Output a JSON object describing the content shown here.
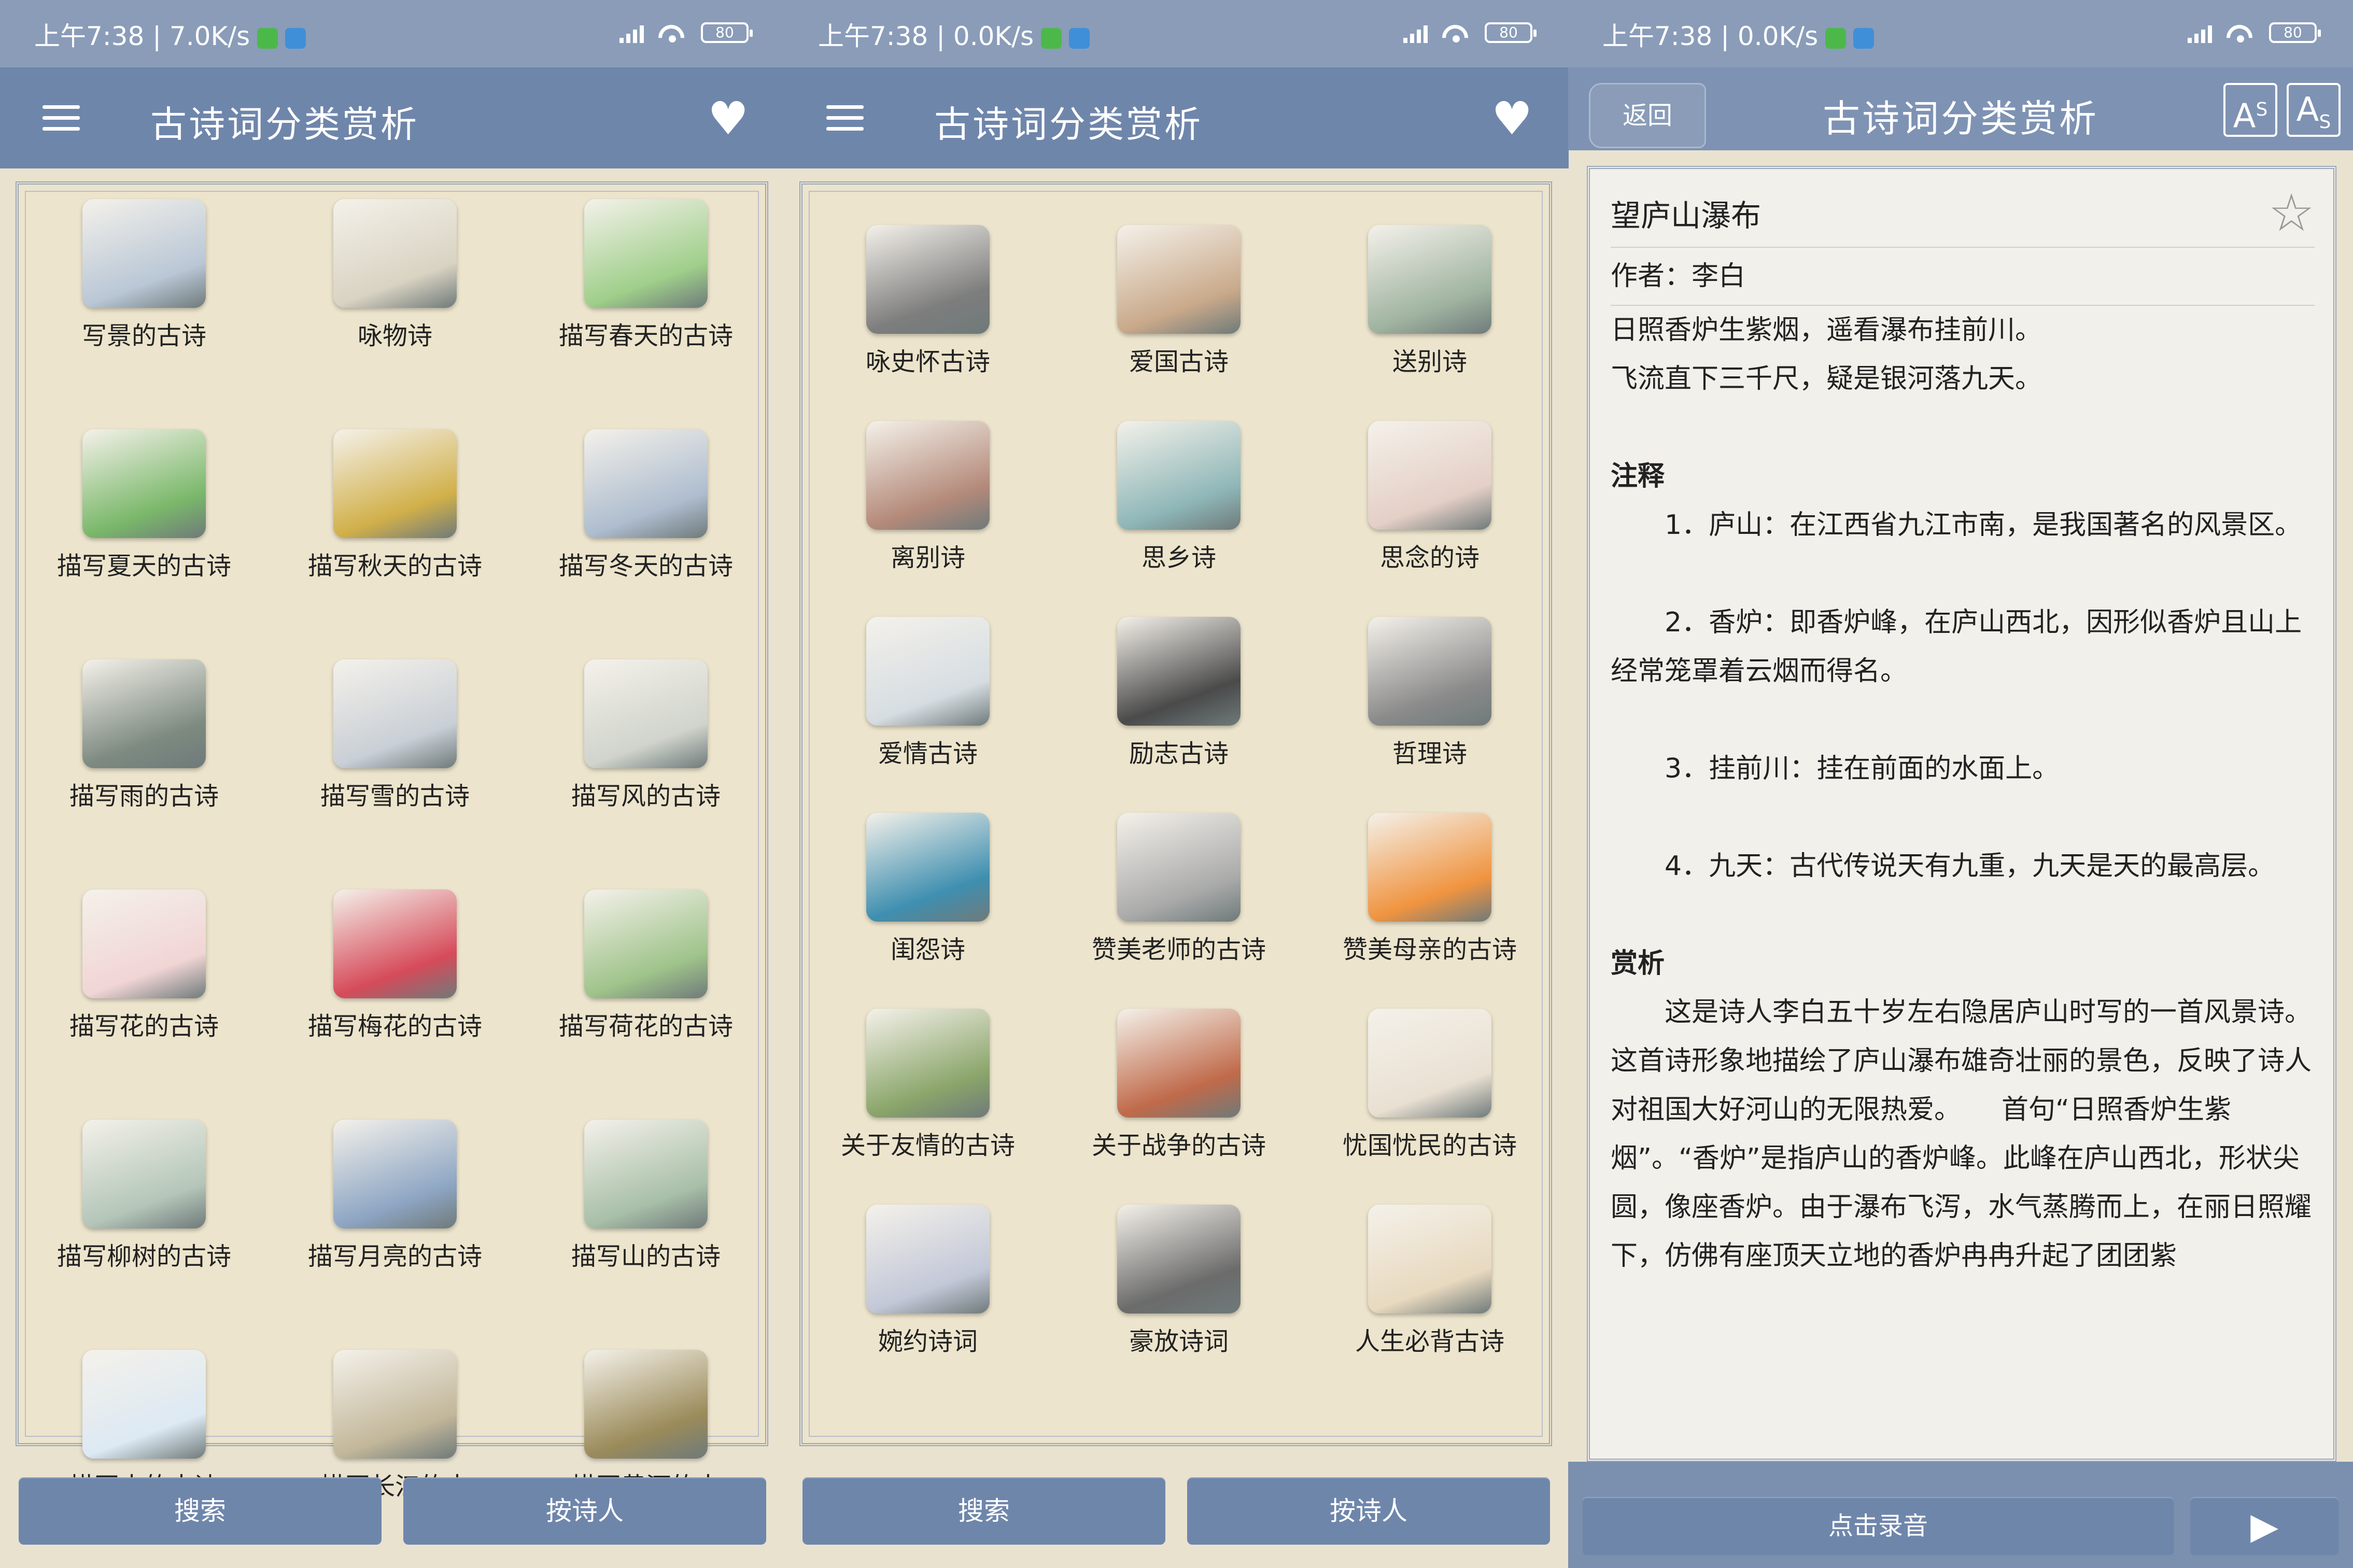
{
  "panels": [
    {
      "status": {
        "time": "上午7:38",
        "speed": "7.0K/s",
        "battery": "80"
      },
      "title": "古诗词分类赏析",
      "items": [
        "写景的古诗",
        "咏物诗",
        "描写春天的古诗",
        "描写夏天的古诗",
        "描写秋天的古诗",
        "描写冬天的古诗",
        "描写雨的古诗",
        "描写雪的古诗",
        "描写风的古诗",
        "描写花的古诗",
        "描写梅花的古诗",
        "描写荷花的古诗",
        "描写柳树的古诗",
        "描写月亮的古诗",
        "描写山的古诗",
        "描写水的古诗",
        "描写长江的古",
        "描写黄河的古"
      ],
      "buttons": {
        "search": "搜索",
        "by_poet": "按诗人"
      }
    },
    {
      "status": {
        "time": "上午7:38",
        "speed": "0.0K/s",
        "battery": "80"
      },
      "title": "古诗词分类赏析",
      "items": [
        "咏史怀古诗",
        "爱国古诗",
        "送别诗",
        "离别诗",
        "思乡诗",
        "思念的诗",
        "爱情古诗",
        "励志古诗",
        "哲理诗",
        "闺怨诗",
        "赞美老师的古诗",
        "赞美母亲的古诗",
        "关于友情的古诗",
        "关于战争的古诗",
        "忧国忧民的古诗",
        "婉约诗词",
        "豪放诗词",
        "人生必背古诗"
      ],
      "buttons": {
        "search": "搜索",
        "by_poet": "按诗人"
      }
    }
  ],
  "detail": {
    "status": {
      "time": "上午7:38",
      "speed": "0.0K/s",
      "battery": "80"
    },
    "back": "返回",
    "title": "古诗词分类赏析",
    "font_up": "A",
    "font_down": "A",
    "poem_title": "望庐山瀑布",
    "author": "作者：李白",
    "lines": [
      "日照香炉生紫烟，遥看瀑布挂前川。",
      "飞流直下三千尺，疑是银河落九天。"
    ],
    "notes_heading": "注释",
    "notes": [
      "1．庐山：在江西省九江市南，是我国著名的风景区。",
      "2．香炉：即香炉峰，在庐山西北，因形似香炉且山上经常笼罩着云烟而得名。",
      "3．挂前川：挂在前面的水面上。",
      "4．九天：古代传说天有九重，九天是天的最高层。"
    ],
    "appreciation_heading": "赏析",
    "appreciation": "这是诗人李白五十岁左右隐居庐山时写的一首风景诗。这首诗形象地描绘了庐山瀑布雄奇壮丽的景色，反映了诗人对祖国大好河山的无限热爱。　　首句“日照香炉生紫烟”。“香炉”是指庐山的香炉峰。此峰在庐山西北，形状尖圆，像座香炉。由于瀑布飞泻，水气蒸腾而上，在丽日照耀下，仿佛有座顶天立地的香炉冉冉升起了团团紫",
    "record": "点击录音",
    "play_icon": "play-icon"
  },
  "colors": {
    "bar": "#6f86ab",
    "status": "#8a9cb8",
    "paper": "#ece4cc"
  }
}
